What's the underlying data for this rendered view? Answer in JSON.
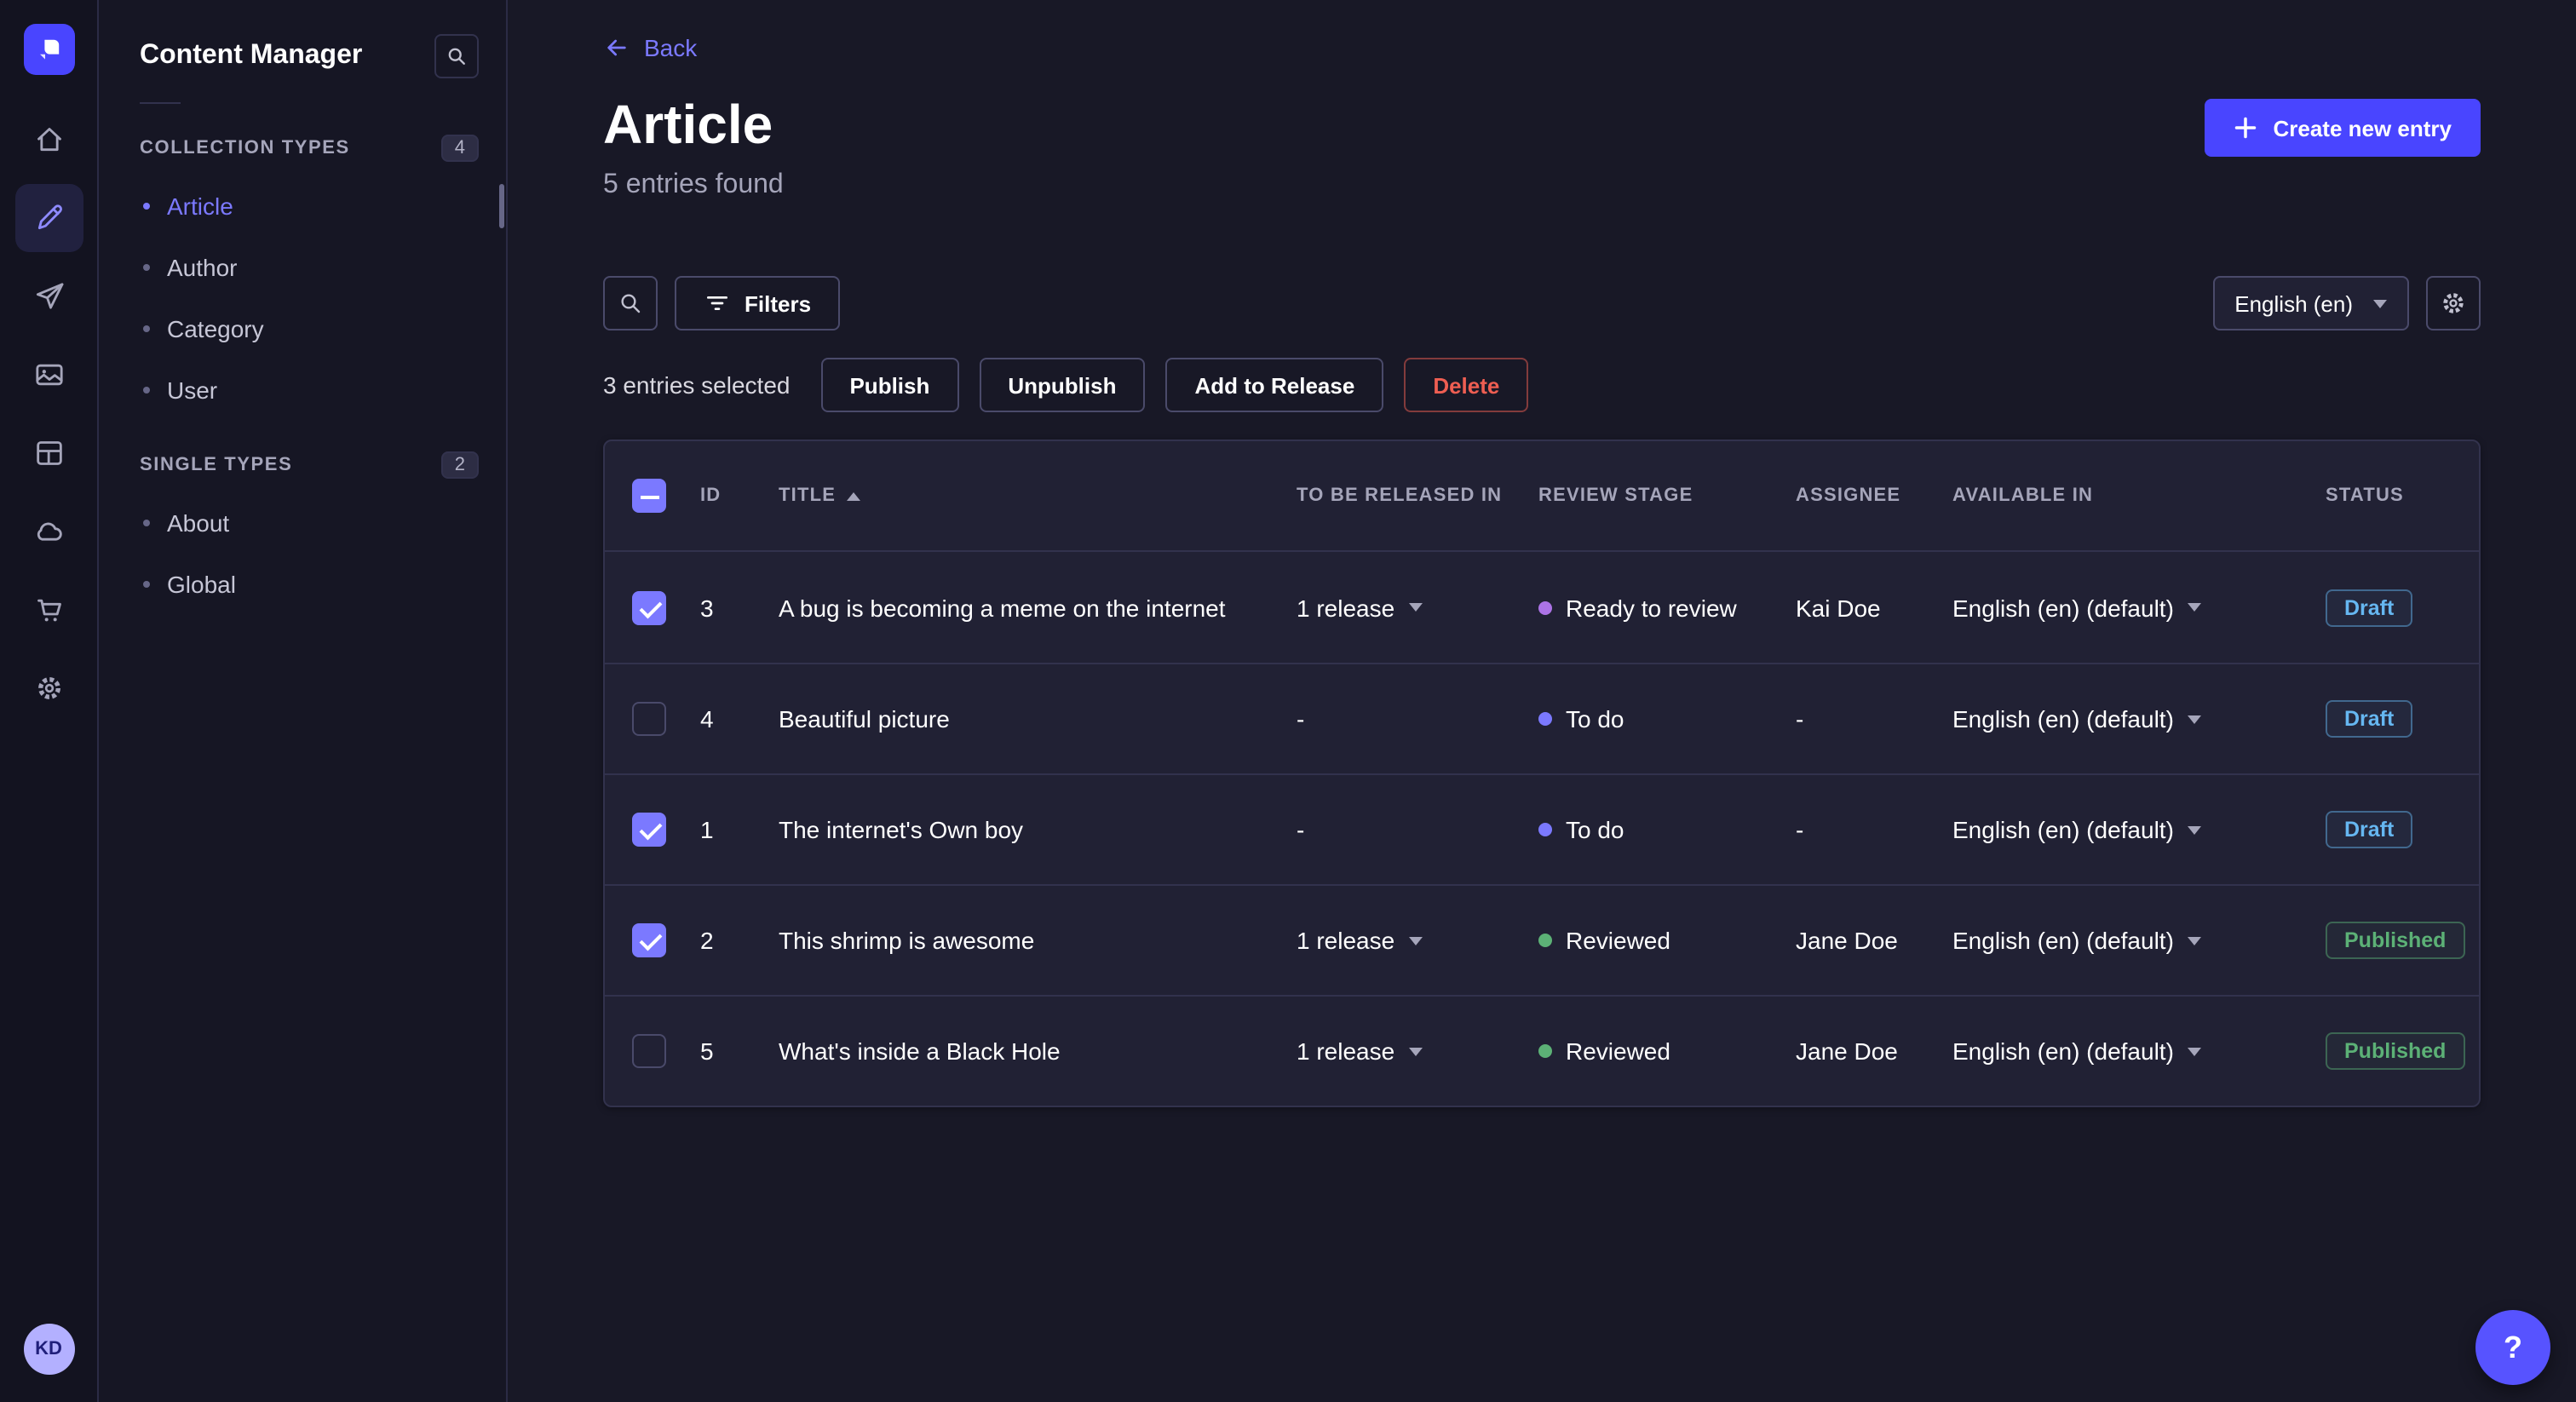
{
  "nav_rail": {
    "items": [
      {
        "icon": "home-icon",
        "active": false
      },
      {
        "icon": "content-manager-icon",
        "active": true
      },
      {
        "icon": "releases-icon",
        "active": false
      },
      {
        "icon": "media-library-icon",
        "active": false
      },
      {
        "icon": "content-type-builder-icon",
        "active": false
      },
      {
        "icon": "deploy-icon",
        "active": false
      },
      {
        "icon": "marketplace-icon",
        "active": false
      },
      {
        "icon": "settings-icon",
        "active": false
      }
    ],
    "avatar_initials": "KD"
  },
  "sidebar": {
    "title": "Content Manager",
    "sections": [
      {
        "label": "COLLECTION TYPES",
        "count": "4",
        "items": [
          {
            "label": "Article",
            "active": true
          },
          {
            "label": "Author",
            "active": false
          },
          {
            "label": "Category",
            "active": false
          },
          {
            "label": "User",
            "active": false
          }
        ]
      },
      {
        "label": "SINGLE TYPES",
        "count": "2",
        "items": [
          {
            "label": "About",
            "active": false
          },
          {
            "label": "Global",
            "active": false
          }
        ]
      }
    ]
  },
  "header": {
    "back_label": "Back",
    "title": "Article",
    "subtitle": "5 entries found",
    "create_button": "Create new entry"
  },
  "toolbar": {
    "filters_label": "Filters",
    "locale_label": "English (en)"
  },
  "selection": {
    "text": "3 entries selected",
    "actions": [
      "Publish",
      "Unpublish",
      "Add to Release",
      "Delete"
    ]
  },
  "table": {
    "columns": [
      "ID",
      "TITLE",
      "TO BE RELEASED IN",
      "REVIEW STAGE",
      "ASSIGNEE",
      "AVAILABLE IN",
      "STATUS"
    ],
    "sort": {
      "column": "TITLE",
      "direction": "ascending"
    },
    "header_checkbox_state": "indeterminate",
    "rows": [
      {
        "selected": true,
        "id": "3",
        "title": "A bug is becoming a meme on the internet",
        "to_be_released_in": "1 release",
        "review_stage": "Ready to review",
        "stage_color": "#ac73e6",
        "assignee": "Kai Doe",
        "available_in": "English (en) (default)",
        "status": "Draft"
      },
      {
        "selected": false,
        "id": "4",
        "title": "Beautiful picture",
        "to_be_released_in": "-",
        "review_stage": "To do",
        "stage_color": "#7b79ff",
        "assignee": "-",
        "available_in": "English (en) (default)",
        "status": "Draft"
      },
      {
        "selected": true,
        "id": "1",
        "title": "The internet's Own boy",
        "to_be_released_in": "-",
        "review_stage": "To do",
        "stage_color": "#7b79ff",
        "assignee": "-",
        "available_in": "English (en) (default)",
        "status": "Draft"
      },
      {
        "selected": true,
        "id": "2",
        "title": "This shrimp is awesome",
        "to_be_released_in": "1 release",
        "review_stage": "Reviewed",
        "stage_color": "#5cb176",
        "assignee": "Jane Doe",
        "available_in": "English (en) (default)",
        "status": "Published"
      },
      {
        "selected": false,
        "id": "5",
        "title": "What's inside a Black Hole",
        "to_be_released_in": "1 release",
        "review_stage": "Reviewed",
        "stage_color": "#5cb176",
        "assignee": "Jane Doe",
        "available_in": "English (en) (default)",
        "status": "Published"
      }
    ]
  },
  "help": {
    "label": "?",
    "icon": "question-mark-icon"
  },
  "colors": {
    "accent": "#4945ff",
    "accent_light": "#7b79ff",
    "draft_status": "#66b7f1",
    "published_status": "#5cb176",
    "danger": "#ee5e52",
    "stage_ready_to_review": "#ac73e6",
    "stage_to_do": "#7b79ff",
    "stage_reviewed": "#5cb176"
  }
}
